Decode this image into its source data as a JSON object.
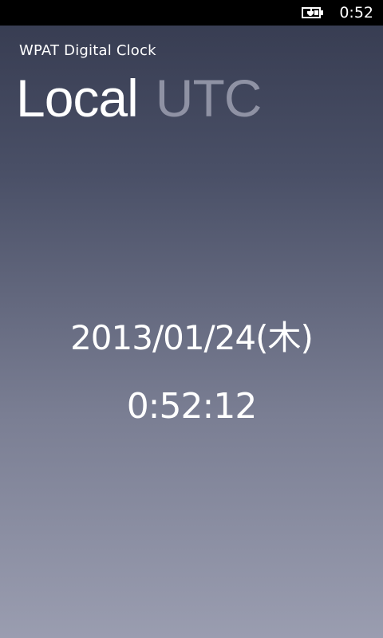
{
  "status_bar": {
    "time": "0:52",
    "battery_icon": "battery-charging-icon"
  },
  "app": {
    "title": "WPAT Digital Clock"
  },
  "pivot": {
    "tabs": [
      {
        "label": "Local",
        "active": true
      },
      {
        "label": "UTC",
        "active": false
      }
    ]
  },
  "clock": {
    "date": "2013/01/24(木)",
    "time": "0:52:12"
  },
  "colors": {
    "status_bar_bg": "#000000",
    "gradient_top": "#353a4f",
    "gradient_bottom": "#9a9db0",
    "active_tab": "#ffffff",
    "inactive_tab": "#8f92a4"
  }
}
